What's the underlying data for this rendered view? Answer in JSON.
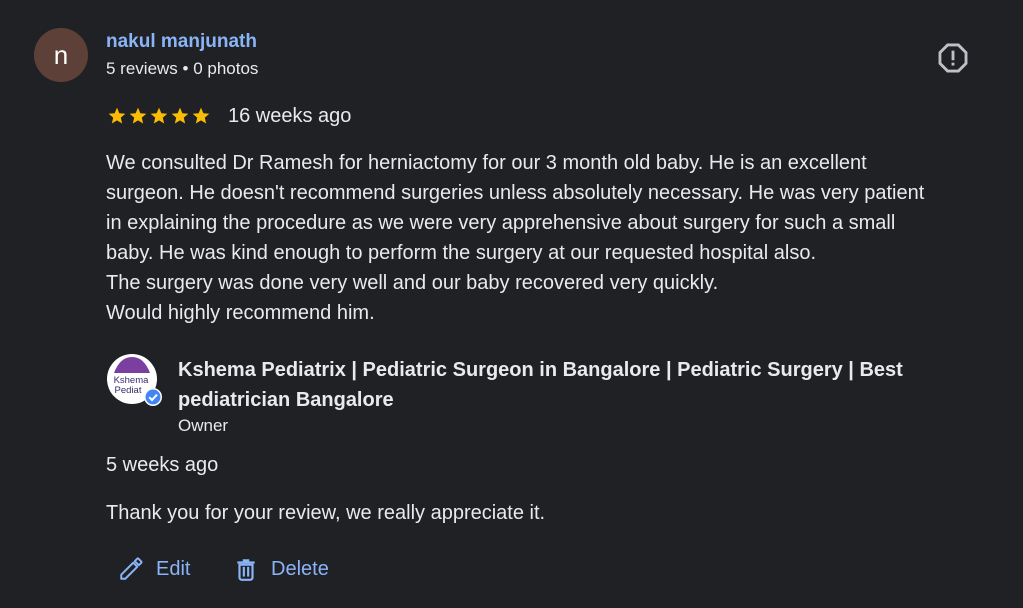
{
  "reviewer": {
    "avatar_letter": "n",
    "avatar_color": "#5d4037",
    "name": "nakul manjunath",
    "meta": "5 reviews • 0 photos"
  },
  "review": {
    "rating": 5,
    "max_rating": 5,
    "star_color": "#fbbc04",
    "date": "16 weeks ago",
    "text": "We consulted Dr Ramesh for herniactomy for our 3 month old baby. He is an excellent\nsurgeon. He doesn't recommend surgeries unless absolutely necessary. He was very patient\nin explaining the procedure as we were very apprehensive about surgery for such a small\nbaby. He was kind enough to perform the surgery at our requested hospital also.\nThe surgery was done very well and our baby recovered very quickly.\nWould highly recommend him."
  },
  "owner_reply": {
    "logo_text_line1": "Kshema",
    "logo_text_line2": "Pediat",
    "name": "Kshema Pediatrix | Pediatric Surgeon in Bangalore | Pediatric Surgery | Best pediatrician Bangalore",
    "role": "Owner",
    "date": "5 weeks ago",
    "text": "Thank you for your review, we really appreciate it."
  },
  "actions": {
    "edit_label": "Edit",
    "delete_label": "Delete"
  },
  "icons": {
    "report": "report-icon",
    "star": "star-icon",
    "verified": "verified-badge-icon",
    "edit": "pencil-icon",
    "delete": "trash-icon"
  },
  "colors": {
    "background": "#202124",
    "link": "#8ab4f8",
    "text": "#e8eaed",
    "verified": "#4285f4"
  }
}
